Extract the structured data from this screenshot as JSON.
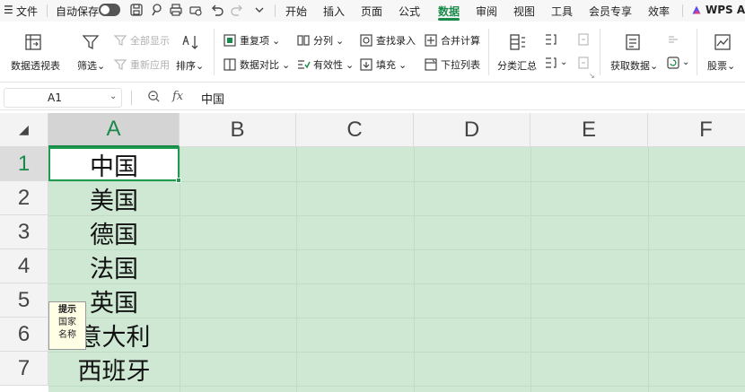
{
  "menubar": {
    "file": "文件",
    "autosave": "自动保存",
    "tabs": [
      "开始",
      "插入",
      "页面",
      "公式",
      "数据",
      "审阅",
      "视图",
      "工具",
      "会员专享",
      "效率"
    ],
    "active_tab": "数据",
    "wps_ai": "WPS AI",
    "accent_color": "#1a8a4a"
  },
  "ribbon": {
    "pivot": "数据透视表",
    "filter": "筛选",
    "show_all": "全部显示",
    "reapply": "重新应用",
    "sort": "排序",
    "duplicates": "重复项",
    "compare": "数据对比",
    "split": "分列",
    "validity": "有效性",
    "find_entry": "查找录入",
    "fill": "填充",
    "consolidate": "合并计算",
    "dropdown_list": "下拉列表",
    "subtotal": "分类汇总",
    "get_data": "获取数据",
    "stocks": "股票"
  },
  "formula_bar": {
    "name_box": "A1",
    "fx": "fx",
    "content": "中国"
  },
  "sheet": {
    "columns": [
      "A",
      "B",
      "C",
      "D",
      "E",
      "F"
    ],
    "rows": [
      "1",
      "2",
      "3",
      "4",
      "5",
      "6",
      "7"
    ],
    "cells_A": [
      "中国",
      "美国",
      "德国",
      "法国",
      "英国",
      "意大利",
      "西班牙"
    ],
    "selected_cell": "A1",
    "selection_color": "#cfe8d4"
  },
  "tooltip": {
    "title": "提示",
    "line1": "国家",
    "line2": "名称"
  }
}
